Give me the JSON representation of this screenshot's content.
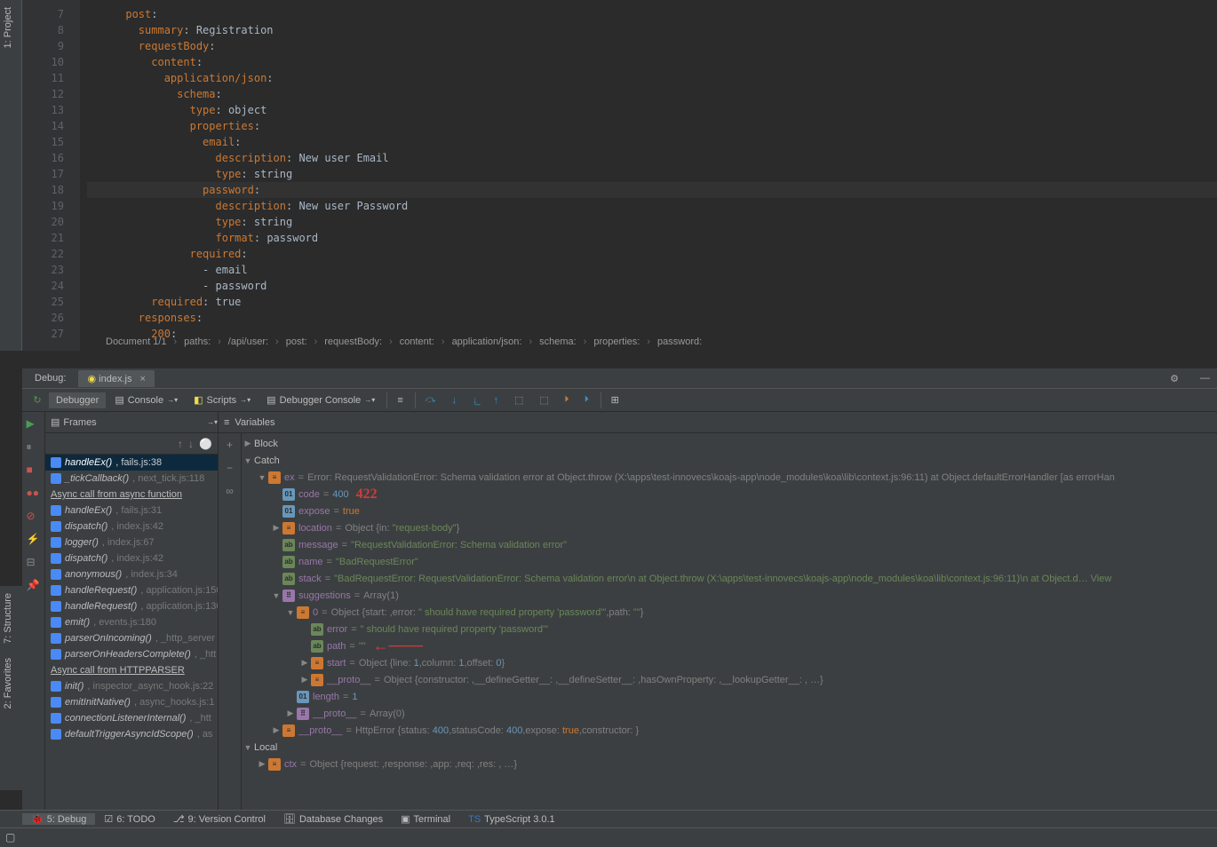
{
  "sidebar_left": {
    "project_tab": "1: Project"
  },
  "sidebar_bottom": {
    "structure_tab": "7: Structure",
    "favorites_tab": "2: Favorites"
  },
  "editor": {
    "line_start": 7,
    "lines": [
      {
        "n": 7,
        "indent": 6,
        "key": "post",
        "colon": true
      },
      {
        "n": 8,
        "indent": 8,
        "key": "summary",
        "val": "Registration"
      },
      {
        "n": 9,
        "indent": 8,
        "key": "requestBody",
        "colon": true
      },
      {
        "n": 10,
        "indent": 10,
        "key": "content",
        "colon": true
      },
      {
        "n": 11,
        "indent": 12,
        "key": "application/json",
        "colon": true
      },
      {
        "n": 12,
        "indent": 14,
        "key": "schema",
        "colon": true
      },
      {
        "n": 13,
        "indent": 16,
        "key": "type",
        "val": "object"
      },
      {
        "n": 14,
        "indent": 16,
        "key": "properties",
        "colon": true
      },
      {
        "n": 15,
        "indent": 18,
        "key": "email",
        "colon": true
      },
      {
        "n": 16,
        "indent": 20,
        "key": "description",
        "val": "New user Email"
      },
      {
        "n": 17,
        "indent": 20,
        "key": "type",
        "val": "string"
      },
      {
        "n": 18,
        "indent": 18,
        "key": "password",
        "colon": true,
        "hl": true
      },
      {
        "n": 19,
        "indent": 20,
        "key": "description",
        "val": "New user Password"
      },
      {
        "n": 20,
        "indent": 20,
        "key": "type",
        "val": "string"
      },
      {
        "n": 21,
        "indent": 20,
        "key": "format",
        "val": "password"
      },
      {
        "n": 22,
        "indent": 16,
        "key": "required",
        "colon": true
      },
      {
        "n": 23,
        "indent": 18,
        "dash": true,
        "val": "email"
      },
      {
        "n": 24,
        "indent": 18,
        "dash": true,
        "val": "password"
      },
      {
        "n": 25,
        "indent": 10,
        "key": "required",
        "val": "true"
      },
      {
        "n": 26,
        "indent": 8,
        "key": "responses",
        "colon": true
      },
      {
        "n": 27,
        "indent": 10,
        "key": "200",
        "colon": true
      }
    ],
    "breadcrumb": [
      "Document 1/1",
      "paths:",
      "/api/user:",
      "post:",
      "requestBody:",
      "content:",
      "application/json:",
      "schema:",
      "properties:",
      "password:"
    ]
  },
  "debug": {
    "title": "Debug:",
    "file_tab": "index.js",
    "tabs": {
      "debugger": "Debugger",
      "console": "Console",
      "scripts": "Scripts",
      "debugger_console": "Debugger Console"
    },
    "frames_title": "Frames",
    "variables_title": "Variables",
    "frames": [
      {
        "func": "handleEx()",
        "loc": "fails.js:38",
        "selected": true
      },
      {
        "func": "_tickCallback()",
        "loc": "next_tick.js:118"
      },
      {
        "async": "Async call from async function"
      },
      {
        "func": "handleEx()",
        "loc": "fails.js:31"
      },
      {
        "func": "dispatch()",
        "loc": "index.js:42"
      },
      {
        "func": "logger()",
        "loc": "index.js:67"
      },
      {
        "func": "dispatch()",
        "loc": "index.js:42"
      },
      {
        "func": "anonymous()",
        "loc": "index.js:34"
      },
      {
        "func": "handleRequest()",
        "loc": "application.js:150"
      },
      {
        "func": "handleRequest()",
        "loc": "application.js:130"
      },
      {
        "func": "emit()",
        "loc": "events.js:180"
      },
      {
        "func": "parserOnIncoming()",
        "loc": "_http_server"
      },
      {
        "func": "parserOnHeadersComplete()",
        "loc": "_htt"
      },
      {
        "async": "Async call from HTTPPARSER"
      },
      {
        "func": "init()",
        "loc": "inspector_async_hook.js:22"
      },
      {
        "func": "emitInitNative()",
        "loc": "async_hooks.js:1"
      },
      {
        "func": "connectionListenerInternal()",
        "loc": "_htt"
      },
      {
        "func": "defaultTriggerAsyncIdScope()",
        "loc": "as"
      }
    ],
    "scopes": {
      "block": "Block",
      "catch": "Catch",
      "local": "Local"
    },
    "ex": {
      "label": "ex",
      "error_text": "Error: RequestValidationError: Schema validation error    at Object.throw (X:\\apps\\test-innovecs\\koajs-app\\node_modules\\koa\\lib\\context.js:96:11)    at Object.defaultErrorHandler [as errorHan",
      "code": "400",
      "expose": "true",
      "location_summary": "Object {in: \"request-body\"}",
      "message": "\"RequestValidationError: Schema validation error\"",
      "name": "\"BadRequestError\"",
      "stack": "\"BadRequestError: RequestValidationError: Schema validation error\\n    at Object.throw (X:\\apps\\test-innovecs\\koajs-app\\node_modules\\koa\\lib\\context.js:96:11)\\n    at Object.d… View",
      "suggestions": {
        "summary": "Array(1)",
        "item0_summary": "Object {start: ,error: \" should have required property 'password'\",path: \"\"}",
        "error": "\" should have required property 'password'\"",
        "path": "\"\"",
        "start_summary": "Object {line: 1,column: 1,offset: 0}",
        "proto_summary": "Object {constructor: ,__defineGetter__: ,__defineSetter__: ,hasOwnProperty: ,__lookupGetter__: , …}"
      },
      "length": "1",
      "proto_arr": "Array(0)",
      "proto_http": "HttpError {status: 400,statusCode: 400,expose: true,constructor: }"
    },
    "ctx_summary": "Object {request: ,response: ,app: ,req: ,res: , …}",
    "annotations": {
      "code_422": "422",
      "arrow": "←"
    }
  },
  "bottom_tabs": {
    "debug": "5: Debug",
    "todo": "6: TODO",
    "version_control": "9: Version Control",
    "database_changes": "Database Changes",
    "terminal": "Terminal",
    "typescript": "TypeScript 3.0.1"
  }
}
